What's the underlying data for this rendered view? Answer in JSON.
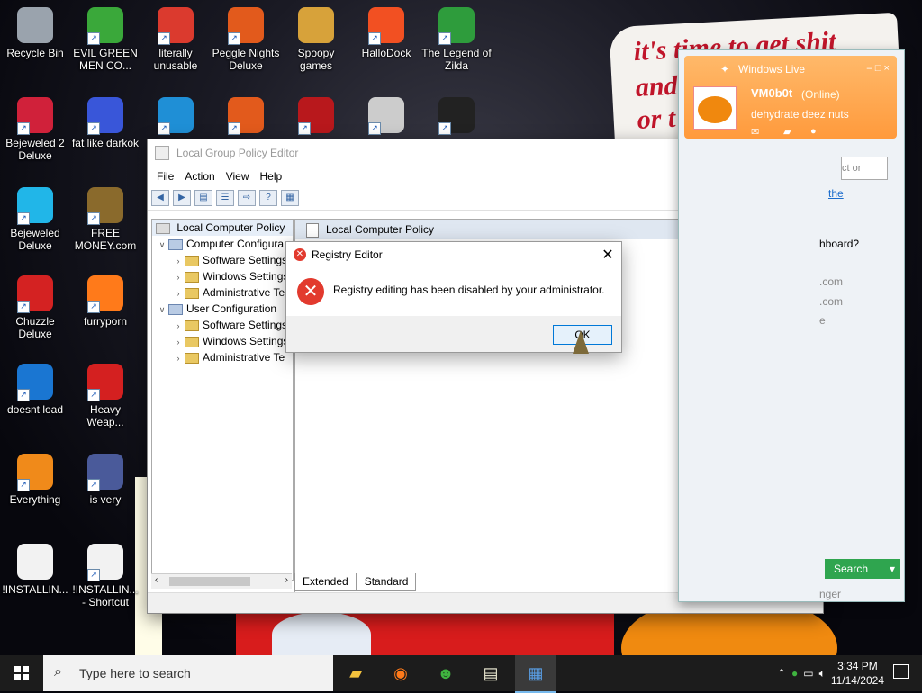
{
  "desktop_icons": [
    {
      "id": "recycle",
      "label": "Recycle Bin",
      "icon": "recycle-bin-icon",
      "color": "#9aa3ad",
      "shortcut": false
    },
    {
      "id": "evil-green",
      "label": "EVIL GREEN MEN CO...",
      "icon": "people-icon",
      "color": "#3aa83a",
      "shortcut": true
    },
    {
      "id": "chrome",
      "label": "literally unusable",
      "icon": "chrome-icon",
      "color": "#db3a2e",
      "shortcut": true
    },
    {
      "id": "peggle",
      "label": "Peggle Nights Deluxe",
      "icon": "peggle-icon",
      "color": "#e25a1c",
      "shortcut": true
    },
    {
      "id": "spoopy",
      "label": "Spoopy games",
      "icon": "folder-icon",
      "color": "#d7a23a",
      "shortcut": false
    },
    {
      "id": "hallodock",
      "label": "HalloDock",
      "icon": "windows-logo-icon",
      "color": "#f25022",
      "shortcut": true
    },
    {
      "id": "zilda",
      "label": "The Legend of Zilda",
      "icon": "zelda-icon",
      "color": "#2e9c3c",
      "shortcut": true
    },
    {
      "id": "bejeweled2",
      "label": "Bejeweled 2 Deluxe",
      "icon": "bejeweled2-icon",
      "color": "#d0213a",
      "shortcut": true
    },
    {
      "id": "darkok",
      "label": "fat like darkok",
      "icon": "mpl-icon",
      "color": "#3956d9",
      "shortcut": true
    },
    {
      "id": "edge",
      "label": "",
      "icon": "edge-icon",
      "color": "#1f8fd6",
      "shortcut": true
    },
    {
      "id": "peggle2",
      "label": "",
      "icon": "peggle-icon",
      "color": "#e25a1c",
      "shortcut": true
    },
    {
      "id": "flash",
      "label": "",
      "icon": "flash-icon",
      "color": "#b8181c",
      "shortcut": true
    },
    {
      "id": "network",
      "label": "",
      "icon": "network-icon",
      "color": "#cccccc",
      "shortcut": true
    },
    {
      "id": "yashma",
      "label": "",
      "icon": "yashma-icon",
      "color": "#222222",
      "shortcut": true
    },
    {
      "id": "bejeweled",
      "label": "Bejeweled Deluxe",
      "icon": "diamond-icon",
      "color": "#21b6e8",
      "shortcut": true
    },
    {
      "id": "freemoney",
      "label": "FREE MONEY.com",
      "icon": "money-bag-icon",
      "color": "#8a6a2c",
      "shortcut": true
    },
    {
      "id": "chuzzle",
      "label": "Chuzzle Deluxe",
      "icon": "chuzzle-icon",
      "color": "#d42222",
      "shortcut": true
    },
    {
      "id": "furryporn",
      "label": "furryporn",
      "icon": "firefox-icon",
      "color": "#ff7a1a",
      "shortcut": true
    },
    {
      "id": "doesntload",
      "label": "doesnt load",
      "icon": "thunderbird-icon",
      "color": "#1a76d2",
      "shortcut": true
    },
    {
      "id": "heavy",
      "label": "Heavy Weap...",
      "icon": "radiation-icon",
      "color": "#d42020",
      "shortcut": true
    },
    {
      "id": "everything",
      "label": "Everything",
      "icon": "search-ring-icon",
      "color": "#f08a1a",
      "shortcut": true
    },
    {
      "id": "isvery",
      "label": "is very",
      "icon": "mpl-shield-icon",
      "color": "#4a5a9a",
      "shortcut": true
    },
    {
      "id": "installing1",
      "label": "!INSTALLIN...",
      "icon": "document-icon",
      "color": "#f2f2f2",
      "shortcut": false
    },
    {
      "id": "installing2",
      "label": "!INSTALLIN... - Shortcut",
      "icon": "document-icon",
      "color": "#f2f2f2",
      "shortcut": true
    }
  ],
  "wallpaper": {
    "chalk_lines": [
      "it's time to get shit",
      "and",
      "or t"
    ]
  },
  "gpedit": {
    "title": "Local Group Policy Editor",
    "controls": {
      "minimize": "—",
      "maximize": "☐",
      "close": "✕"
    },
    "menu": [
      "File",
      "Action",
      "View",
      "Help"
    ],
    "tree_root": "Local Computer Policy",
    "tree": [
      {
        "label": "Computer Configura",
        "level": 1,
        "chevron": "∨",
        "kind": "computer"
      },
      {
        "label": "Software Settings",
        "level": 2,
        "chevron": "›",
        "kind": "folder"
      },
      {
        "label": "Windows Settings",
        "level": 2,
        "chevron": "›",
        "kind": "folder"
      },
      {
        "label": "Administrative Te",
        "level": 2,
        "chevron": "›",
        "kind": "folder"
      },
      {
        "label": "User Configuration",
        "level": 1,
        "chevron": "∨",
        "kind": "user"
      },
      {
        "label": "Software Settings",
        "level": 2,
        "chevron": "›",
        "kind": "folder"
      },
      {
        "label": "Windows Settings",
        "level": 2,
        "chevron": "›",
        "kind": "folder"
      },
      {
        "label": "Administrative Te",
        "level": 2,
        "chevron": "›",
        "kind": "folder"
      }
    ],
    "right_header": "Local Computer Policy",
    "tabs": [
      "Extended",
      "Standard"
    ]
  },
  "dialog": {
    "title": "Registry Editor",
    "message": "Registry editing has been disabled by your administrator.",
    "ok_label": "OK",
    "close": "✕"
  },
  "messenger": {
    "title": "Windows Live",
    "controls": "– □ ×",
    "name": "VM0b0t",
    "status": "(Online)",
    "personal_message": "dehydrate deez nuts",
    "search_placeholder": "ct or numbe",
    "link_text": "the",
    "lines": [
      "hboard?",
      ".com",
      ".com",
      "e"
    ],
    "search_button": "Search",
    "footer_text": "nger"
  },
  "taskbar": {
    "search_placeholder": "Type here to search",
    "apps": [
      {
        "id": "explorer",
        "icon": "folder-icon",
        "active": false
      },
      {
        "id": "firefox",
        "icon": "firefox-icon",
        "active": false
      },
      {
        "id": "messenger",
        "icon": "people-icon",
        "active": false
      },
      {
        "id": "notepad",
        "icon": "notepad-icon",
        "active": false
      },
      {
        "id": "gpedit",
        "icon": "policy-icon",
        "active": true
      }
    ],
    "time": "3:34 PM",
    "date": "11/14/2024"
  }
}
